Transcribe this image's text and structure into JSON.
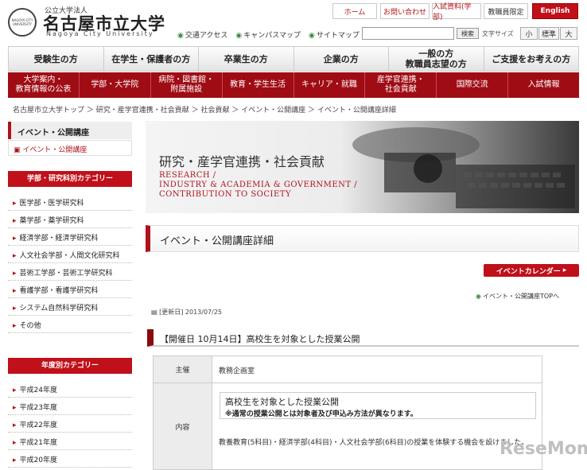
{
  "header": {
    "logo_circle_text": "NAGOYA CITY UNIVERSITY",
    "logo_sub": "公立大学法人",
    "logo_main": "名古屋市立大学",
    "logo_en": "Nagoya City University",
    "top_buttons": [
      "ホーム",
      "お問い合わせ",
      "入試資料(学部)",
      "教職員限定",
      "English"
    ],
    "sub_links": [
      "交通アクセス",
      "キャンパスマップ",
      "サイトマップ"
    ],
    "search_placeholder": "",
    "search_button": "検索",
    "font_size_label": "文字サイズ",
    "font_sizes": [
      "小",
      "標準",
      "大"
    ]
  },
  "nav_primary": [
    {
      "label": "受験生の方"
    },
    {
      "label": "在学生・保護者の方"
    },
    {
      "label": "卒業生の方"
    },
    {
      "label": "企業の方"
    },
    {
      "label": "一般の方\n教職員志望の方"
    },
    {
      "label": "ご支援をお考えの方"
    }
  ],
  "nav_secondary": [
    {
      "label": "大学案内・\n教育情報の公表"
    },
    {
      "label": "学部・大学院"
    },
    {
      "label": "病院・図書館・\n附属施設"
    },
    {
      "label": "教育・学生生活"
    },
    {
      "label": "キャリア・就職"
    },
    {
      "label": "産学官連携・\n社会貢献"
    },
    {
      "label": "国際交流"
    },
    {
      "label": "入試情報"
    }
  ],
  "breadcrumb": "名古屋市立大学トップ ＞ 研究・産学官連携・社会貢献 ＞ 社会貢献 ＞ イベント・公開講座 ＞ イベント・公開講座詳細",
  "sidebar": {
    "heading": "イベント・公開講座",
    "active_item": "イベント・公開講座",
    "category_heading": "学部・研究科別カテゴリー",
    "categories": [
      "医学部・医学研究科",
      "薬学部・薬学研究科",
      "経済学部・経済学研究科",
      "人文社会学部・人間文化研究科",
      "芸術工学部・芸術工学研究科",
      "看護学部・看護学研究科",
      "システム自然科学研究科",
      "その他"
    ],
    "year_heading": "年度別カテゴリー",
    "years": [
      "平成24年度",
      "平成23年度",
      "平成22年度",
      "平成21年度",
      "平成20年度"
    ]
  },
  "banner": {
    "title_jp": "研究・産学官連携・社会貢献",
    "title_en_1": "RESEARCH /",
    "title_en_2": "INDUSTRY & ACADEMIA & GOVERNMENT /",
    "title_en_3": "CONTRIBUTION TO SOCIETY"
  },
  "main": {
    "section_title": "イベント・公開講座詳細",
    "calendar_button": "イベントカレンダー",
    "top_link": "イベント・公開講座TOPへ",
    "updated": "[更新日] 2013/07/25",
    "event_title": "【開催日 10月14日】高校生を対象とした授業公開",
    "table": {
      "organizer_label": "主催",
      "organizer_value": "教務企画室",
      "content_label": "内容",
      "content_box_title": "高校生を対象とした授業公開",
      "content_box_note": "※通常の授業公開とは対象者及び申込み方法が異なります。",
      "content_text": "教養教育(5科目)・経済学部(4科目)・人文社会学部(6科目)の授業を体験する機会を設けました。"
    }
  },
  "watermark": "ReseMom"
}
